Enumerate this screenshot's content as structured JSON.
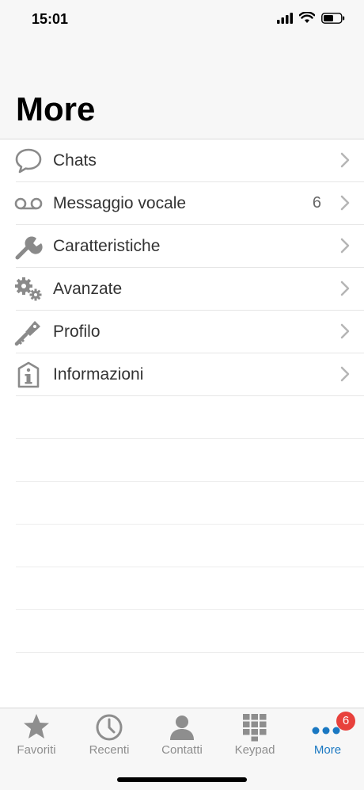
{
  "status_bar": {
    "time": "15:01"
  },
  "header": {
    "title": "More"
  },
  "menu": [
    {
      "label": "Chats",
      "icon": "chat-bubble-icon",
      "count": ""
    },
    {
      "label": "Messaggio vocale",
      "icon": "voicemail-icon",
      "count": "6"
    },
    {
      "label": "Caratteristiche",
      "icon": "wrench-icon",
      "count": ""
    },
    {
      "label": "Avanzate",
      "icon": "gears-icon",
      "count": ""
    },
    {
      "label": "Profilo",
      "icon": "key-icon",
      "count": ""
    },
    {
      "label": "Informazioni",
      "icon": "info-tag-icon",
      "count": ""
    }
  ],
  "tabs": [
    {
      "label": "Favoriti",
      "icon": "star-icon"
    },
    {
      "label": "Recenti",
      "icon": "clock-icon"
    },
    {
      "label": "Contatti",
      "icon": "person-icon"
    },
    {
      "label": "Keypad",
      "icon": "keypad-icon"
    },
    {
      "label": "More",
      "icon": "more-dots-icon",
      "badge": "6"
    }
  ],
  "colors": {
    "accent": "#1a78c2",
    "badge": "#e8413c",
    "icon_gray": "#8a8a8a"
  }
}
